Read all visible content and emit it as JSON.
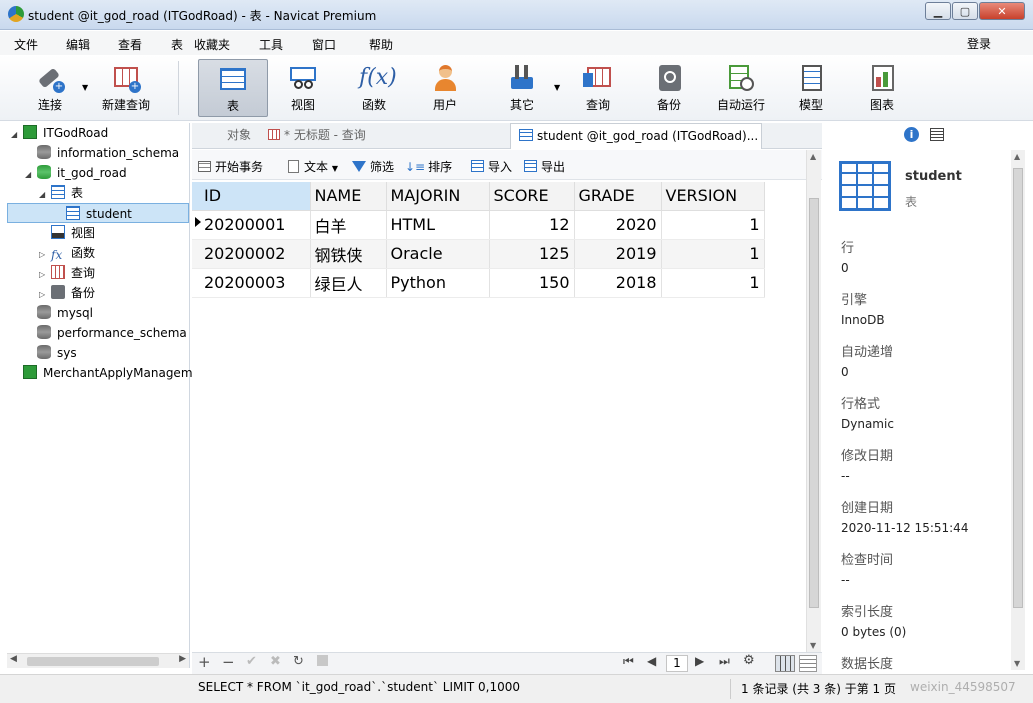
{
  "window": {
    "title": "student @it_god_road (ITGodRoad) - 表 - Navicat Premium"
  },
  "menu": [
    "文件",
    "编辑",
    "查看",
    "表",
    "收藏夹",
    "工具",
    "窗口",
    "帮助"
  ],
  "account": {
    "login_label": "登录"
  },
  "toolbar": [
    {
      "label": "连接",
      "icon": "plug-icon"
    },
    {
      "label": "新建查询",
      "icon": "new-query-icon"
    },
    {
      "label": "表",
      "icon": "table-icon",
      "active": true
    },
    {
      "label": "视图",
      "icon": "view-icon"
    },
    {
      "label": "函数",
      "icon": "function-icon"
    },
    {
      "label": "用户",
      "icon": "user-icon"
    },
    {
      "label": "其它",
      "icon": "tools-icon"
    },
    {
      "label": "查询",
      "icon": "query-icon"
    },
    {
      "label": "备份",
      "icon": "backup-icon"
    },
    {
      "label": "自动运行",
      "icon": "schedule-icon"
    },
    {
      "label": "模型",
      "icon": "model-icon"
    },
    {
      "label": "图表",
      "icon": "chart-icon"
    }
  ],
  "tree": [
    {
      "label": "ITGodRoad",
      "level": 0,
      "icon": "connection-icon",
      "expander": "◢"
    },
    {
      "label": "information_schema",
      "level": 1,
      "icon": "database-icon",
      "expander": ""
    },
    {
      "label": "it_god_road",
      "level": 1,
      "icon": "database-open-icon",
      "expander": "◢"
    },
    {
      "label": "表",
      "level": 2,
      "icon": "tables-icon",
      "expander": "◢"
    },
    {
      "label": "student",
      "level": 3,
      "icon": "table-icon",
      "expander": "",
      "selected": true
    },
    {
      "label": "视图",
      "level": 2,
      "icon": "views-icon",
      "expander": ""
    },
    {
      "label": "函数",
      "level": 2,
      "icon": "function-icon",
      "expander": "▷"
    },
    {
      "label": "查询",
      "level": 2,
      "icon": "query-icon",
      "expander": "▷"
    },
    {
      "label": "备份",
      "level": 2,
      "icon": "backup-icon",
      "expander": "▷"
    },
    {
      "label": "mysql",
      "level": 1,
      "icon": "database-icon",
      "expander": ""
    },
    {
      "label": "performance_schema",
      "level": 1,
      "icon": "database-icon",
      "expander": ""
    },
    {
      "label": "sys",
      "level": 1,
      "icon": "database-icon",
      "expander": ""
    },
    {
      "label": "MerchantApplyManagem",
      "level": 0,
      "icon": "connection-icon",
      "expander": ""
    }
  ],
  "tabs": {
    "objects": "对象",
    "untitled": "* 无标题 - 查询",
    "active": "student @it_god_road (ITGodRoad)..."
  },
  "gridbar": {
    "begin": "开始事务",
    "text": "文本",
    "filter": "筛选",
    "sort": "排序",
    "import": "导入",
    "export": "导出"
  },
  "table": {
    "columns": [
      "ID",
      "NAME",
      "MAJORIN",
      "SCORE",
      "GRADE",
      "VERSION"
    ],
    "rows": [
      [
        "20200001",
        "白羊",
        "HTML",
        "12",
        "2020",
        "1"
      ],
      [
        "20200002",
        "钢铁侠",
        "Oracle",
        "125",
        "2019",
        "1"
      ],
      [
        "20200003",
        "绿巨人",
        "Python",
        "150",
        "2018",
        "1"
      ]
    ]
  },
  "pager": {
    "page": "1"
  },
  "info": {
    "name": "student",
    "type": "表",
    "fields": [
      {
        "label": "行",
        "value": "0"
      },
      {
        "label": "引擎",
        "value": "InnoDB"
      },
      {
        "label": "自动递增",
        "value": "0"
      },
      {
        "label": "行格式",
        "value": "Dynamic"
      },
      {
        "label": "修改日期",
        "value": "--"
      },
      {
        "label": "创建日期",
        "value": "2020-11-12 15:51:44"
      },
      {
        "label": "检查时间",
        "value": "--"
      },
      {
        "label": "索引长度",
        "value": "0 bytes (0)"
      },
      {
        "label": "数据长度",
        "value": ""
      }
    ]
  },
  "status": {
    "sql": "SELECT * FROM `it_god_road`.`student` LIMIT 0,1000",
    "records": "1 条记录 (共 3 条) 于第 1 页",
    "watermark": "weixin_44598507"
  },
  "colors": {
    "accent": "#2e74c9",
    "selection": "#cce4f7"
  }
}
